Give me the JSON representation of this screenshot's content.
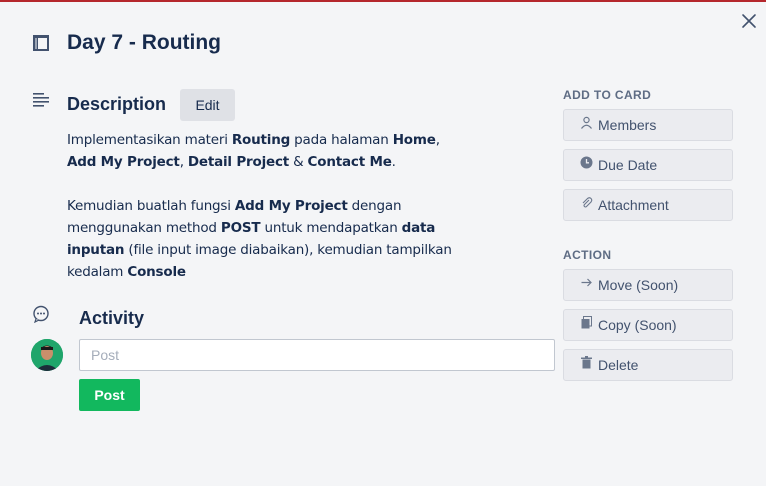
{
  "card": {
    "title": "Day 7 - Routing"
  },
  "description": {
    "heading": "Description",
    "edit_label": "Edit",
    "paragraphs": [
      [
        {
          "t": "Implementasikan materi ",
          "b": false
        },
        {
          "t": "Routing",
          "b": true
        },
        {
          "t": " pada halaman ",
          "b": false
        },
        {
          "t": "Home",
          "b": true
        },
        {
          "t": ", ",
          "b": false
        },
        {
          "t": "Add My Project",
          "b": true
        },
        {
          "t": ", ",
          "b": false
        },
        {
          "t": "Detail Project",
          "b": true
        },
        {
          "t": " & ",
          "b": false
        },
        {
          "t": "Contact Me",
          "b": true
        },
        {
          "t": ".",
          "b": false
        }
      ],
      [
        {
          "t": "Kemudian buatlah fungsi ",
          "b": false
        },
        {
          "t": "Add My Project",
          "b": true
        },
        {
          "t": " dengan menggunakan method ",
          "b": false
        },
        {
          "t": "POST",
          "b": true
        },
        {
          "t": " untuk mendapatkan ",
          "b": false
        },
        {
          "t": "data inputan",
          "b": true
        },
        {
          "t": " (file input image diabaikan), kemudian tampilkan kedalam ",
          "b": false
        },
        {
          "t": "Console",
          "b": true
        }
      ]
    ]
  },
  "activity": {
    "heading": "Activity",
    "input_placeholder": "Post",
    "post_label": "Post"
  },
  "sidebar": {
    "add_to_card_label": "ADD TO CARD",
    "add_items": [
      {
        "label": "Members",
        "icon": "person-icon"
      },
      {
        "label": "Due Date",
        "icon": "clock-icon"
      },
      {
        "label": "Attachment",
        "icon": "paperclip-icon"
      }
    ],
    "action_label": "ACTION",
    "action_items": [
      {
        "label": "Move (Soon)",
        "icon": "arrow-right-icon"
      },
      {
        "label": "Copy (Soon)",
        "icon": "copy-icon"
      },
      {
        "label": "Delete",
        "icon": "trash-icon"
      }
    ]
  },
  "colors": {
    "accent_bar": "#b5272d",
    "post_button": "#12b85e",
    "text": "#172b4d",
    "muted": "#5e6c84"
  }
}
